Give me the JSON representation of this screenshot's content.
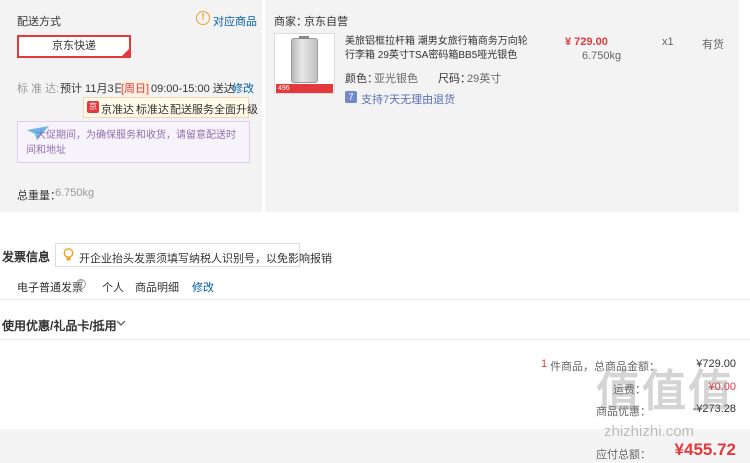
{
  "shipping": {
    "title": "配送方式",
    "help_link": "对应商品",
    "method": "京东快递",
    "date_label": "标 准 达:",
    "date_prefix": "预计 11月3日",
    "date_weekday": "[周日]",
    "date_time": "09:00-15:00 送达",
    "modify": "修改",
    "upgrade_badge": "京",
    "upgrade_1": "京准达",
    "upgrade_2": "标准达",
    "upgrade_3": "配送服务全面升级",
    "notice": "大促期间，为确保服务和收货，请留意配送时间和地址",
    "weight_label": "总重量：",
    "weight_value": "6.750kg"
  },
  "product": {
    "seller_label": "商家：",
    "seller_name": "京东自营",
    "title": "美旅铝框拉杆箱 潮男女旅行箱商务万向轮行李箱 29英寸TSA密码箱BB5哑光银色",
    "price": "¥ 729.00",
    "weight": "6.750kg",
    "qty": "x1",
    "stock": "有货",
    "color_label": "颜色：",
    "color_value": "亚光银色",
    "size_label": "尺码：",
    "size_value": "29英寸",
    "return_policy": "支持7天无理由退货",
    "image_tag": "496"
  },
  "invoice": {
    "title": "发票信息",
    "tip": "开企业抬头发票须填写纳税人识别号，以免影响报销",
    "type": "电子普通发票",
    "header": "个人",
    "content": "商品明细",
    "modify": "修改"
  },
  "coupon": {
    "title": "使用优惠/礼品卡/抵用"
  },
  "summary": {
    "count": "1",
    "items_text": "件商品，总商品金额：",
    "items_total": "¥729.00",
    "row2_label": "运费：",
    "row2_value": "¥0.00",
    "row3_label": "商品优惠：",
    "row3_value": "-¥273.28",
    "payable_label": "应付总额：",
    "payable_value": "¥455.72"
  },
  "watermark": "zhizhizhi.com"
}
